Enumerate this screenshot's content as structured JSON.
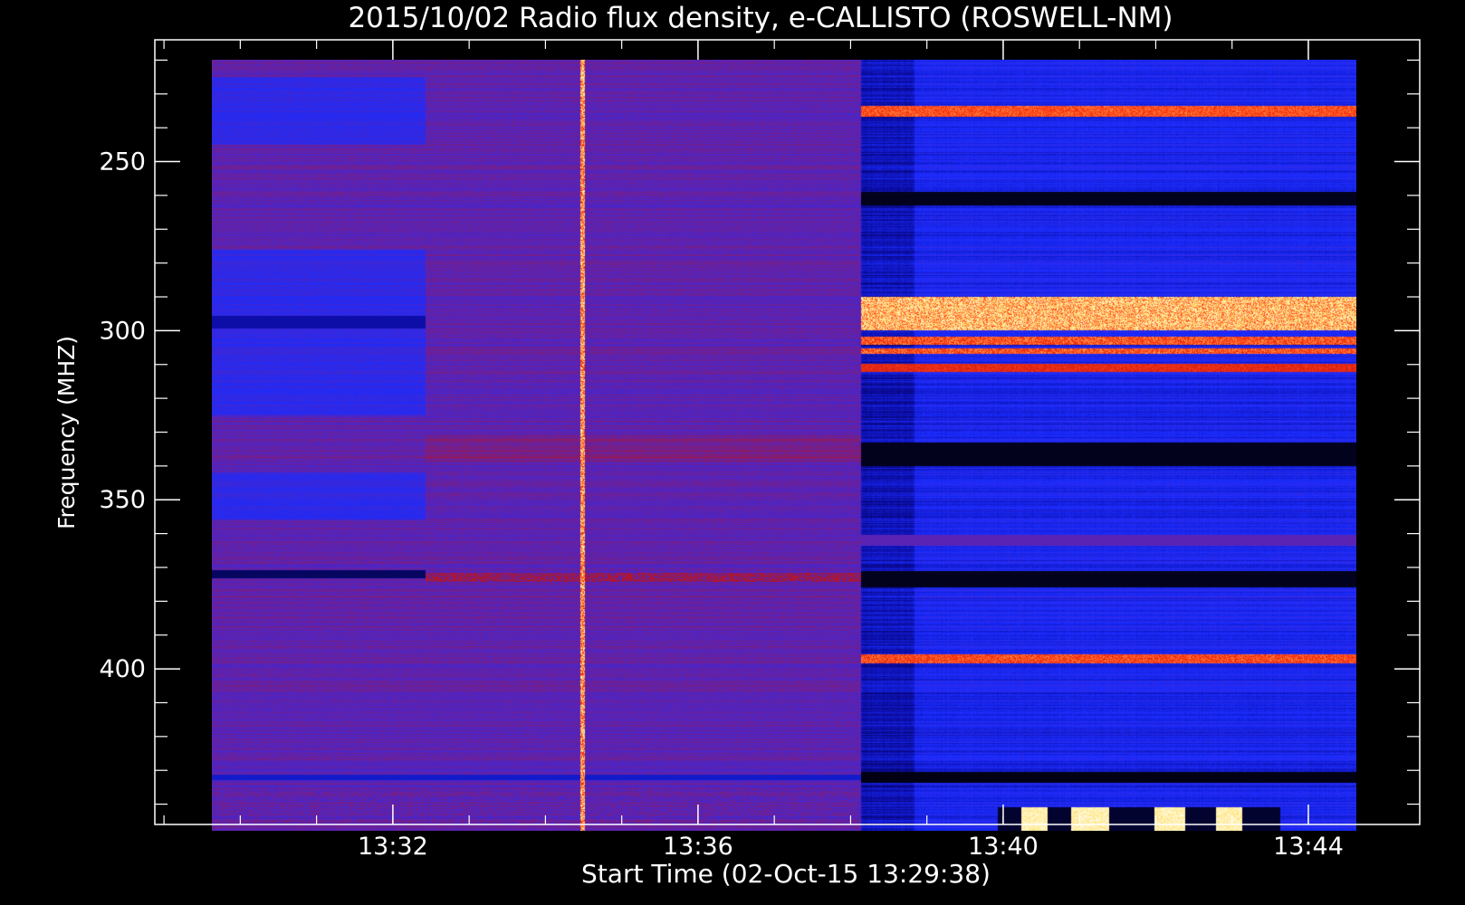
{
  "chart_data": {
    "type": "heatmap",
    "title": "2015/10/02  Radio flux density, e-CALLISTO (ROSWELL-NM)",
    "xlabel": "Start Time (02-Oct-15 13:29:38)",
    "ylabel": "Frequency (MHZ)",
    "x_ticks": [
      "13:32",
      "13:36",
      "13:40",
      "13:44"
    ],
    "x_tick_minutes": [
      2.37,
      6.37,
      10.37,
      14.37
    ],
    "y_ticks": [
      250,
      300,
      350,
      400
    ],
    "ylim": [
      214,
      446
    ],
    "xlim_minutes": [
      -0.75,
      15.83
    ],
    "colormap": [
      "#000000",
      "#0a0a9a",
      "#1a2cff",
      "#5a23b4",
      "#c01414",
      "#ff3c14",
      "#ffe070",
      "#fffff0"
    ],
    "colors": {
      "background": "#000000",
      "axis": "#ffffff",
      "quiet_sun": "#5a23b4",
      "burst_band": "#ffe070"
    },
    "time_range_minutes": [
      0,
      15
    ],
    "freq_range_mhz": [
      220,
      448
    ],
    "event": {
      "onset_minutes": 8.5,
      "description_shown": false
    },
    "emission_bands_mhz": [
      235,
      293,
      295,
      299,
      303,
      306,
      311,
      397,
      362,
      373
    ],
    "gap_segments": [
      {
        "time_start": 0,
        "time_end": 2.8,
        "freq_start": 296,
        "freq_end": 299
      },
      {
        "time_start": 0,
        "time_end": 2.8,
        "freq_start": 371,
        "freq_end": 373
      },
      {
        "time_start": 8.5,
        "time_end": 15,
        "freq_start": 333,
        "freq_end": 340
      },
      {
        "time_start": 8.5,
        "time_end": 15,
        "freq_start": 371,
        "freq_end": 376
      },
      {
        "time_start": 8.5,
        "time_end": 15,
        "freq_start": 259,
        "freq_end": 263
      }
    ]
  }
}
